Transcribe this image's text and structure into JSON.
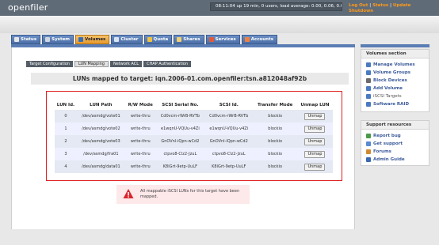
{
  "header": {
    "logo": "openfiler",
    "uptime": "08:11:04 up 19 min, 0 users, load average: 0.00, 0.06, 0.04",
    "log_out": "Log Out",
    "status": "Status",
    "update": "Update",
    "shutdown": "Shutdown",
    "sep": "|"
  },
  "nav": {
    "tabs": [
      {
        "label": "Status",
        "icon": "status-icon",
        "color": "#e6e6e6"
      },
      {
        "label": "System",
        "icon": "system-icon",
        "color": "#cfd6df"
      },
      {
        "label": "Volumes",
        "icon": "volumes-icon",
        "color": "#3a6fb8"
      },
      {
        "label": "Cluster",
        "icon": "cluster-icon",
        "color": "#d9e4f2"
      },
      {
        "label": "Quota",
        "icon": "quota-icon",
        "color": "#f0c040"
      },
      {
        "label": "Shares",
        "icon": "shares-icon",
        "color": "#f0d070"
      },
      {
        "label": "Services",
        "icon": "services-icon",
        "color": "#e05a3a"
      },
      {
        "label": "Accounts",
        "icon": "accounts-icon",
        "color": "#f08040"
      }
    ],
    "active_index": 2
  },
  "subtabs": [
    "Target Configuration",
    "LUN Mapping",
    "Network ACL",
    "CHAP Authentication"
  ],
  "page_title": "LUNs mapped to target: iqn.2006-01.com.openfiler:tsn.a812048af92b",
  "table": {
    "columns": [
      "LUN Id.",
      "LUN Path",
      "R/W Mode",
      "SCSI Serial No.",
      "SCSI Id.",
      "Transfer Mode",
      "Unmap LUN"
    ],
    "rows": [
      {
        "id": "0",
        "path": "/dev/asmdg/vote01",
        "mode": "write-thru",
        "serial": "Cd0vcm-rWrB-RVTb",
        "scsi_id": "Cd0vcm-rWrB-RVTb",
        "transfer": "blockio",
        "action": "Unmap"
      },
      {
        "id": "1",
        "path": "/dev/asmdg/vote02",
        "mode": "write-thru",
        "serial": "e1wqnU-VQUu-v4Zi",
        "scsi_id": "e1wqnU-VQUu-v4Zi",
        "transfer": "blockio",
        "action": "Unmap"
      },
      {
        "id": "2",
        "path": "/dev/asmdg/vote03",
        "mode": "write-thru",
        "serial": "GnOVnl-iQpn-wCd2",
        "scsi_id": "GnOVnl-iQpn-wCd2",
        "transfer": "blockio",
        "action": "Unmap"
      },
      {
        "id": "3",
        "path": "/dev/asmdg/fra01",
        "mode": "write-thru",
        "serial": "ctpvo8-Clz2-JzuL",
        "scsi_id": "ctpvo8-Clz2-JzuL",
        "transfer": "blockio",
        "action": "Unmap"
      },
      {
        "id": "4",
        "path": "/dev/asmdg/data01",
        "mode": "write-thru",
        "serial": "K8iGrt-9etp-UuLF",
        "scsi_id": "K8iGrt-9etp-UuLF",
        "transfer": "blockio",
        "action": "Unmap"
      }
    ]
  },
  "alert": {
    "text": "All mappable iSCSI LUNs for this target have been mapped.",
    "icon": "warning-icon"
  },
  "sidebar": {
    "volumes_section": {
      "title": "Volumes section",
      "items": [
        {
          "label": "Manage Volumes",
          "icon": "manage-volumes-icon",
          "color": "#4a7ac0",
          "link": true
        },
        {
          "label": "Volume Groups",
          "icon": "volume-groups-icon",
          "color": "#4a7ac0",
          "link": true
        },
        {
          "label": "Block Devices",
          "icon": "block-devices-icon",
          "color": "#6a6a6a",
          "link": true
        },
        {
          "label": "Add Volume",
          "icon": "add-volume-icon",
          "color": "#4a7ac0",
          "link": true
        },
        {
          "label": "iSCSI Targets",
          "icon": "iscsi-targets-icon",
          "color": "#4a7ac0",
          "link": false
        },
        {
          "label": "Software RAID",
          "icon": "software-raid-icon",
          "color": "#4a7ac0",
          "link": true
        }
      ]
    },
    "support_resources": {
      "title": "Support resources",
      "items": [
        {
          "label": "Report bug",
          "icon": "report-bug-icon",
          "color": "#4a9a4a"
        },
        {
          "label": "Get support",
          "icon": "get-support-icon",
          "color": "#5a8ad0"
        },
        {
          "label": "Forums",
          "icon": "forums-icon",
          "color": "#d08a30"
        },
        {
          "label": "Admin Guide",
          "icon": "admin-guide-icon",
          "color": "#3a6ab0"
        }
      ]
    }
  }
}
